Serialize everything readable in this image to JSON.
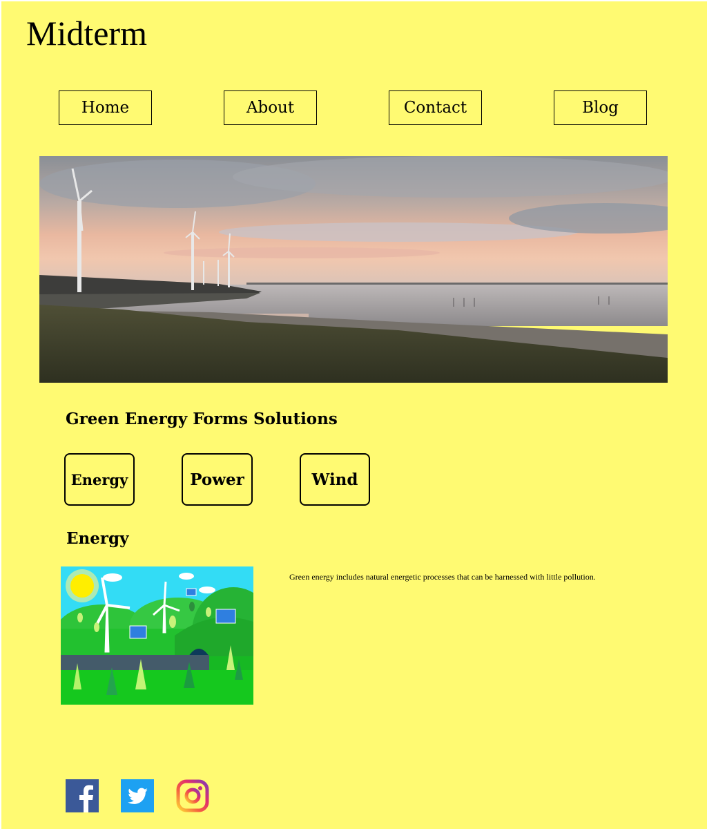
{
  "site": {
    "title": "Midterm"
  },
  "nav": [
    {
      "label": "Home"
    },
    {
      "label": "About"
    },
    {
      "label": "Contact"
    },
    {
      "label": "Blog"
    }
  ],
  "section": {
    "title": "Green Energy Forms Solutions"
  },
  "tabs": [
    {
      "label": "Energy"
    },
    {
      "label": "Power"
    },
    {
      "label": "Wind"
    }
  ],
  "content": {
    "heading": "Energy",
    "description": "Green energy includes natural energetic processes that can be harnessed with little pollution."
  },
  "social": [
    {
      "icon": "facebook-icon",
      "color": "#3b5998"
    },
    {
      "icon": "twitter-icon",
      "color": "#1da1f2"
    },
    {
      "icon": "instagram-icon",
      "color": "#e1306c"
    }
  ],
  "colors": {
    "background": "#fffa72"
  }
}
